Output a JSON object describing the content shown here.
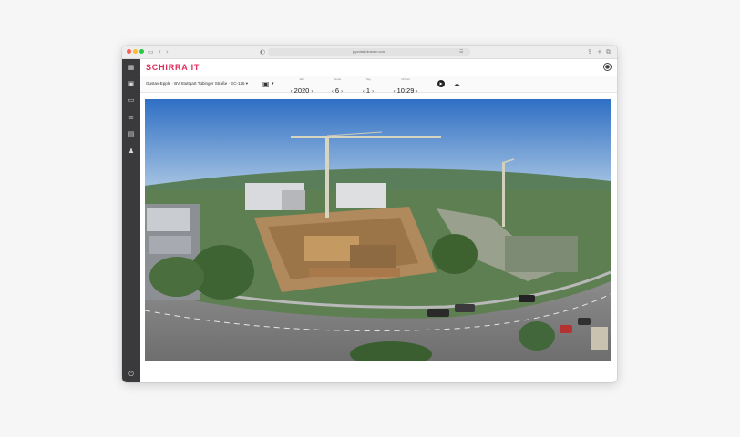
{
  "browser": {
    "url": "p.portal.domain.com"
  },
  "app": {
    "logo": "SCHIRRA IT"
  },
  "toolbar": {
    "camera": "Gustav-Epple · BV Stuttgart Tübinger Straße · EC-126",
    "year": {
      "label": "Jahr",
      "value": "2020"
    },
    "month": {
      "label": "Monat",
      "value": "6"
    },
    "day": {
      "label": "Tag",
      "value": "1"
    },
    "time": {
      "label": "Uhrzeit",
      "value": "10:29"
    }
  },
  "sidebar": {
    "icons": [
      "grid-icon",
      "camera-icon",
      "folder-icon",
      "list-icon",
      "calendar-icon",
      "users-icon"
    ],
    "bottom_icon": "power-icon"
  },
  "colors": {
    "accent": "#e02d5c",
    "sidebar": "#3a3a3c"
  }
}
